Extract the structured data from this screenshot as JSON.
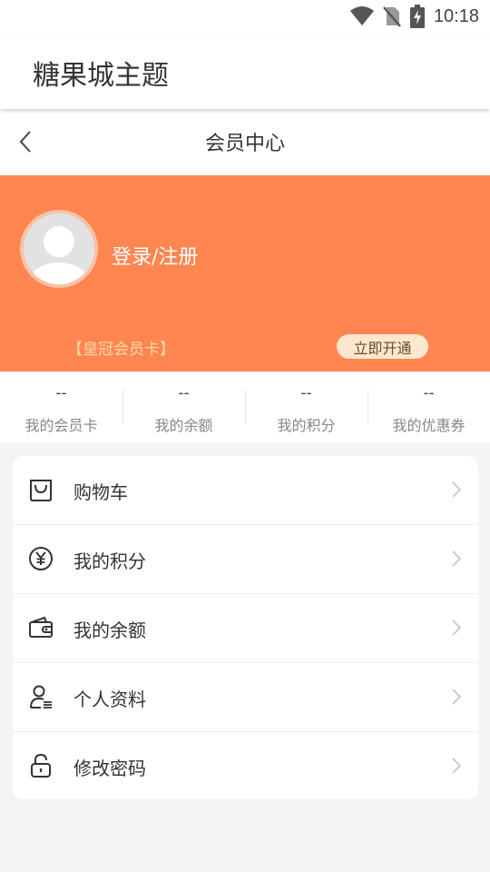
{
  "status_bar": {
    "time": "10:18"
  },
  "app": {
    "title": "糖果城主题"
  },
  "nav": {
    "title": "会员中心"
  },
  "profile": {
    "login_text": "登录/注册",
    "vip_card_label": "【皇冠会员卡】",
    "open_button": "立即开通"
  },
  "stats": [
    {
      "value": "--",
      "label": "我的会员卡"
    },
    {
      "value": "--",
      "label": "我的余额"
    },
    {
      "value": "--",
      "label": "我的积分"
    },
    {
      "value": "--",
      "label": "我的优惠券"
    }
  ],
  "menu": [
    {
      "label": "购物车",
      "icon": "shopping-bag-icon"
    },
    {
      "label": "我的积分",
      "icon": "yen-coin-icon"
    },
    {
      "label": "我的余额",
      "icon": "wallet-icon"
    },
    {
      "label": "个人资料",
      "icon": "user-profile-icon"
    },
    {
      "label": "修改密码",
      "icon": "lock-icon"
    }
  ],
  "colors": {
    "banner": "#ff8650",
    "vip_label": "#ffd9a8",
    "open_button_bg": "#fde7cf"
  }
}
